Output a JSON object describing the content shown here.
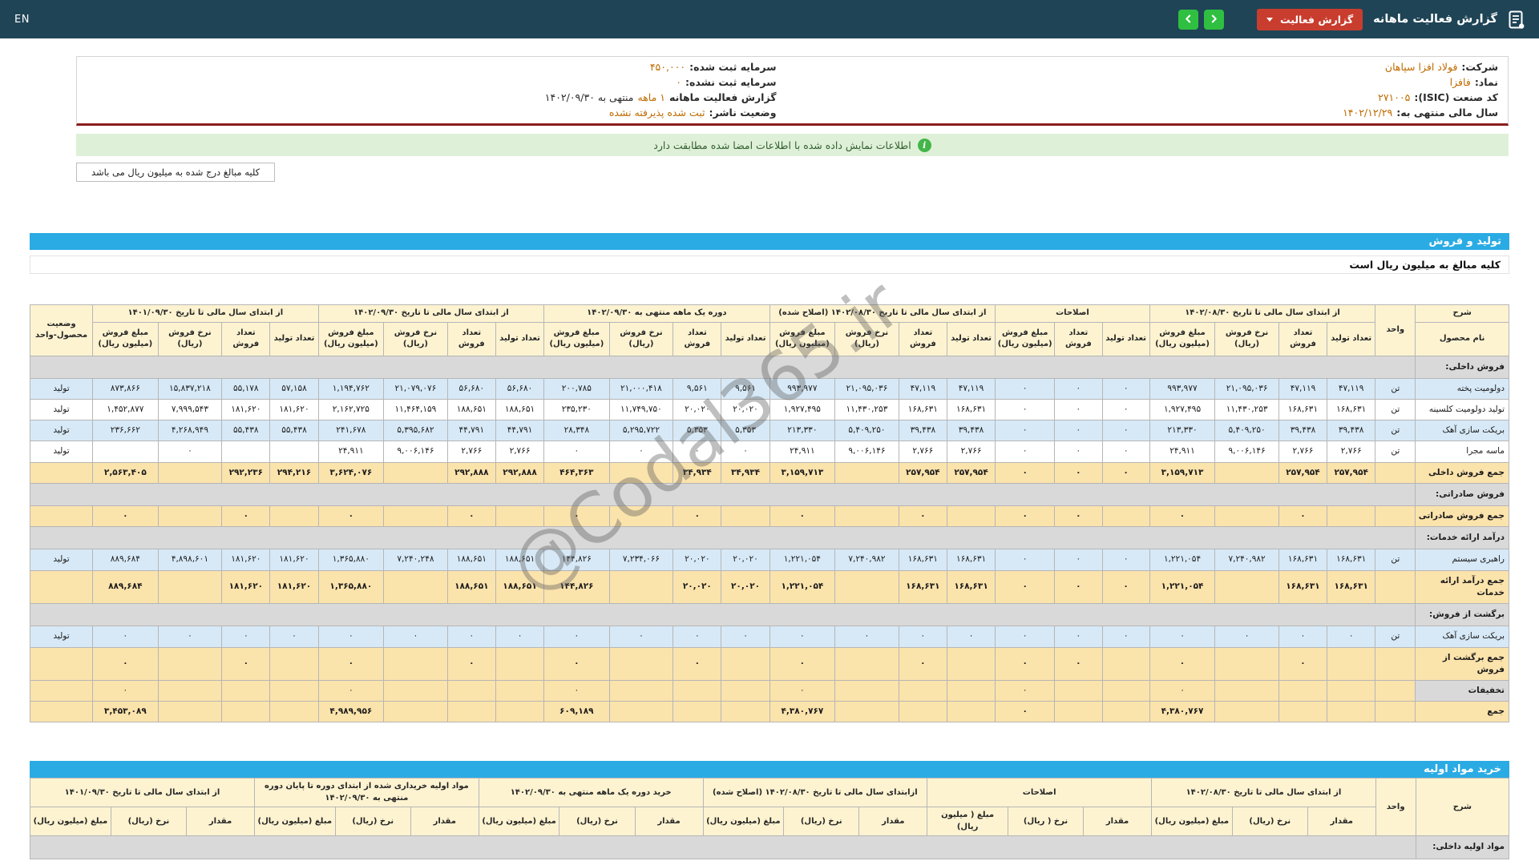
{
  "colors": {
    "topbar": "#1f4456",
    "blue": "#2aabe3",
    "red": "#c93d2e",
    "green": "#2fbf41",
    "maroon": "#8a1c1c",
    "notice_bg": "#dff0d8",
    "header_bg": "#fdf3d1",
    "sum_bg": "#fbe3ac",
    "alt_bg": "#d7e9f7",
    "sec_bg": "#d9d9d9",
    "orange": "#bf6b00"
  },
  "header": {
    "title": "گزارش فعالیت ماهانه",
    "dropdown_label": "گزارش فعالیت",
    "lang": "EN"
  },
  "info": {
    "right": [
      {
        "label": "شرکت:",
        "value": "فولاد افزا سپاهان"
      },
      {
        "label": "نماد:",
        "value": "فافزا"
      },
      {
        "label": "کد صنعت (ISIC):",
        "value": "۲۷۱۰۰۵"
      },
      {
        "label": "سال مالی منتهی به:",
        "value": "۱۴۰۲/۱۲/۲۹"
      }
    ],
    "left": [
      {
        "label": "سرمایه ثبت شده:",
        "value": "۴۵۰,۰۰۰"
      },
      {
        "label": "سرمایه ثبت نشده:",
        "value": "۰"
      },
      {
        "label": "گزارش فعالیت ماهانه",
        "value": "۱ ماهه",
        "suffix": "منتهی به ۱۴۰۲/۰۹/۳۰"
      },
      {
        "label": "وضعیت ناشر:",
        "value": "ثبت شده پذیرفته نشده"
      }
    ]
  },
  "notice": "اطلاعات نمایش داده شده با اطلاعات امضا شده مطابقت دارد",
  "unit_tab": "کلیه مبالغ درج شده به میلیون ریال می باشد",
  "watermark": "@Codal365.ir",
  "sales": {
    "title": "تولید و فروش",
    "subtitle": "کلیه مبالغ به میلیون ریال است",
    "col_desc": "شرح",
    "col_name": "نام محصول",
    "col_unit": "واحد",
    "col_status": "وضعیت محصول-واحد",
    "groups": [
      {
        "title": "از ابتدای سال مالی تا تاریخ ۱۴۰۲/۰۸/۳۰",
        "cols": [
          "تعداد تولید",
          "تعداد فروش",
          "نرخ فروش (ریال)",
          "مبلغ فروش (میلیون ریال)"
        ]
      },
      {
        "title": "اصلاحات",
        "cols": [
          "تعداد تولید",
          "تعداد فروش",
          "مبلغ فروش (میلیون ریال)"
        ]
      },
      {
        "title": "از ابتدای سال مالی تا تاریخ ۱۴۰۲/۰۸/۳۰ (اصلاح شده)",
        "cols": [
          "تعداد تولید",
          "تعداد فروش",
          "نرخ فروش (ریال)",
          "مبلغ فروش (میلیون ریال)"
        ]
      },
      {
        "title": "دوره یک ماهه منتهی به ۱۴۰۲/۰۹/۳۰",
        "cols": [
          "تعداد تولید",
          "تعداد فروش",
          "نرخ فروش (ریال)",
          "مبلغ فروش (میلیون ریال)"
        ]
      },
      {
        "title": "از ابتدای سال مالی تا تاریخ ۱۴۰۲/۰۹/۳۰",
        "cols": [
          "تعداد تولید",
          "تعداد فروش",
          "نرخ فروش (ریال)",
          "مبلغ فروش (میلیون ریال)"
        ]
      },
      {
        "title": "از ابتدای سال مالی تا تاریخ ۱۴۰۱/۰۹/۳۰",
        "cols": [
          "تعداد تولید",
          "تعداد فروش",
          "نرخ فروش (ریال)",
          "مبلغ فروش (میلیون ریال)"
        ]
      }
    ],
    "rows": [
      {
        "type": "section",
        "name": "فروش داخلی:"
      },
      {
        "type": "data",
        "variant": "alt",
        "name": "دولومیت پخته",
        "unit": "تن",
        "status": "تولید",
        "cells": [
          "۴۷,۱۱۹",
          "۴۷,۱۱۹",
          "۲۱,۰۹۵,۰۳۶",
          "۹۹۳,۹۷۷",
          "۰",
          "۰",
          "۰",
          "۴۷,۱۱۹",
          "۴۷,۱۱۹",
          "۲۱,۰۹۵,۰۳۶",
          "۹۹۳,۹۷۷",
          "۹,۵۶۱",
          "۹,۵۶۱",
          "۲۱,۰۰۰,۴۱۸",
          "۲۰۰,۷۸۵",
          "۵۶,۶۸۰",
          "۵۶,۶۸۰",
          "۲۱,۰۷۹,۰۷۶",
          "۱,۱۹۴,۷۶۲",
          "۵۷,۱۵۸",
          "۵۵,۱۷۸",
          "۱۵,۸۳۷,۲۱۸",
          "۸۷۳,۸۶۶"
        ]
      },
      {
        "type": "data",
        "variant": "",
        "name": "تولید دولومیت کلسینه",
        "unit": "تن",
        "status": "تولید",
        "cells": [
          "۱۶۸,۶۳۱",
          "۱۶۸,۶۳۱",
          "۱۱,۴۳۰,۲۵۳",
          "۱,۹۲۷,۴۹۵",
          "۰",
          "۰",
          "۰",
          "۱۶۸,۶۳۱",
          "۱۶۸,۶۳۱",
          "۱۱,۴۳۰,۲۵۳",
          "۱,۹۲۷,۴۹۵",
          "۲۰,۰۲۰",
          "۲۰,۰۲۰",
          "۱۱,۷۴۹,۷۵۰",
          "۲۳۵,۲۳۰",
          "۱۸۸,۶۵۱",
          "۱۸۸,۶۵۱",
          "۱۱,۴۶۴,۱۵۹",
          "۲,۱۶۲,۷۲۵",
          "۱۸۱,۶۲۰",
          "۱۸۱,۶۲۰",
          "۷,۹۹۹,۵۴۳",
          "۱,۴۵۲,۸۷۷"
        ]
      },
      {
        "type": "data",
        "variant": "alt",
        "name": "بریکت سازی آهک",
        "unit": "تن",
        "status": "تولید",
        "cells": [
          "۳۹,۴۳۸",
          "۳۹,۴۳۸",
          "۵,۴۰۹,۲۵۰",
          "۲۱۳,۳۳۰",
          "۰",
          "۰",
          "۰",
          "۳۹,۴۳۸",
          "۳۹,۴۳۸",
          "۵,۴۰۹,۲۵۰",
          "۲۱۳,۳۳۰",
          "۵,۳۵۳",
          "۵,۳۵۳",
          "۵,۲۹۵,۷۲۲",
          "۲۸,۳۴۸",
          "۴۴,۷۹۱",
          "۴۴,۷۹۱",
          "۵,۳۹۵,۶۸۲",
          "۲۴۱,۶۷۸",
          "۵۵,۴۳۸",
          "۵۵,۴۳۸",
          "۴,۲۶۸,۹۴۹",
          "۲۳۶,۶۶۲"
        ]
      },
      {
        "type": "data",
        "variant": "",
        "name": "ماسه مجرا",
        "unit": "تن",
        "status": "تولید",
        "cells": [
          "۲,۷۶۶",
          "۲,۷۶۶",
          "۹,۰۰۶,۱۴۶",
          "۲۴,۹۱۱",
          "۰",
          "۰",
          "۰",
          "۲,۷۶۶",
          "۲,۷۶۶",
          "۹,۰۰۶,۱۴۶",
          "۲۴,۹۱۱",
          "۰",
          "۰",
          "۰",
          "۰",
          "۲,۷۶۶",
          "۲,۷۶۶",
          "۹,۰۰۶,۱۴۶",
          "۲۴,۹۱۱",
          "",
          "",
          "۰",
          ""
        ]
      },
      {
        "type": "data",
        "variant": "sum",
        "name": "جمع فروش داخلی",
        "unit": "",
        "status": "",
        "cells": [
          "۲۵۷,۹۵۴",
          "۲۵۷,۹۵۴",
          "",
          "۳,۱۵۹,۷۱۳",
          "۰",
          "۰",
          "۰",
          "۲۵۷,۹۵۴",
          "۲۵۷,۹۵۴",
          "",
          "۳,۱۵۹,۷۱۳",
          "۳۴,۹۳۴",
          "۳۴,۹۳۴",
          "",
          "۴۶۴,۳۶۳",
          "۲۹۲,۸۸۸",
          "۲۹۲,۸۸۸",
          "",
          "۳,۶۲۴,۰۷۶",
          "۲۹۴,۲۱۶",
          "۲۹۲,۲۳۶",
          "",
          "۲,۵۶۳,۴۰۵"
        ]
      },
      {
        "type": "section",
        "name": "فروش صادراتی:"
      },
      {
        "type": "data",
        "variant": "sum",
        "name": "جمع فروش صادراتی",
        "unit": "",
        "status": "",
        "cells": [
          "",
          "۰",
          "",
          "۰",
          "",
          "۰",
          "۰",
          "",
          "۰",
          "",
          "۰",
          "",
          "۰",
          "",
          "۰",
          "",
          "۰",
          "",
          "۰",
          "",
          "۰",
          "",
          "۰"
        ]
      },
      {
        "type": "section",
        "name": "درآمد ارائه خدمات:"
      },
      {
        "type": "data",
        "variant": "alt",
        "name": "راهبری سیستم",
        "unit": "تن",
        "status": "تولید",
        "cells": [
          "۱۶۸,۶۳۱",
          "۱۶۸,۶۳۱",
          "۷,۲۴۰,۹۸۲",
          "۱,۲۲۱,۰۵۴",
          "۰",
          "۰",
          "۰",
          "۱۶۸,۶۳۱",
          "۱۶۸,۶۳۱",
          "۷,۲۴۰,۹۸۲",
          "۱,۲۲۱,۰۵۴",
          "۲۰,۰۲۰",
          "۲۰,۰۲۰",
          "۷,۲۳۴,۰۶۶",
          "۱۴۴,۸۲۶",
          "۱۸۸,۶۵۱",
          "۱۸۸,۶۵۱",
          "۷,۲۴۰,۲۴۸",
          "۱,۳۶۵,۸۸۰",
          "۱۸۱,۶۲۰",
          "۱۸۱,۶۲۰",
          "۴,۸۹۸,۶۰۱",
          "۸۸۹,۶۸۴"
        ]
      },
      {
        "type": "data",
        "variant": "sum",
        "name": "جمع درآمد ارائه خدمات",
        "unit": "",
        "status": "",
        "cells": [
          "۱۶۸,۶۳۱",
          "۱۶۸,۶۳۱",
          "",
          "۱,۲۲۱,۰۵۴",
          "۰",
          "۰",
          "۰",
          "۱۶۸,۶۳۱",
          "۱۶۸,۶۳۱",
          "",
          "۱,۲۲۱,۰۵۴",
          "۲۰,۰۲۰",
          "۲۰,۰۲۰",
          "",
          "۱۴۴,۸۲۶",
          "۱۸۸,۶۵۱",
          "۱۸۸,۶۵۱",
          "",
          "۱,۳۶۵,۸۸۰",
          "۱۸۱,۶۲۰",
          "۱۸۱,۶۲۰",
          "",
          "۸۸۹,۶۸۴"
        ]
      },
      {
        "type": "section",
        "name": "برگشت از فروش:"
      },
      {
        "type": "data",
        "variant": "alt",
        "name": "بریکت سازی آهک",
        "unit": "تن",
        "status": "تولید",
        "cells": [
          "۰",
          "۰",
          "۰",
          "۰",
          "۰",
          "۰",
          "۰",
          "۰",
          "۰",
          "۰",
          "۰",
          "۰",
          "۰",
          "۰",
          "۰",
          "۰",
          "۰",
          "۰",
          "۰",
          "۰",
          "۰",
          "۰",
          "۰"
        ]
      },
      {
        "type": "data",
        "variant": "sum",
        "name": "جمع برگشت از فروش",
        "unit": "",
        "status": "",
        "cells": [
          "",
          "۰",
          "",
          "۰",
          "",
          "۰",
          "۰",
          "",
          "۰",
          "",
          "۰",
          "",
          "۰",
          "",
          "۰",
          "",
          "۰",
          "",
          "۰",
          "",
          "۰",
          "",
          "۰"
        ]
      },
      {
        "type": "data",
        "variant": "disc",
        "name": "تخفیفات",
        "unit": "",
        "status": "",
        "cells": [
          "",
          "",
          "",
          "۰",
          "",
          "",
          "۰",
          "",
          "",
          "",
          "۰",
          "",
          "",
          "",
          "۰",
          "",
          "",
          "",
          "۰",
          "",
          "",
          "",
          "۰"
        ]
      },
      {
        "type": "data",
        "variant": "sum",
        "name": "جمع",
        "unit": "",
        "status": "",
        "cells": [
          "",
          "",
          "",
          "۴,۳۸۰,۷۶۷",
          "",
          "",
          "۰",
          "",
          "",
          "",
          "۴,۳۸۰,۷۶۷",
          "",
          "",
          "",
          "۶۰۹,۱۸۹",
          "",
          "",
          "",
          "۴,۹۸۹,۹۵۶",
          "",
          "",
          "",
          "۳,۴۵۳,۰۸۹"
        ]
      }
    ]
  },
  "purchase": {
    "title": "خرید مواد اولیه",
    "col_desc": "شرح",
    "col_unit": "واحد",
    "groups": [
      {
        "title": "از ابتدای سال مالی تا تاریخ ۱۴۰۲/۰۸/۳۰",
        "cols": [
          "مقدار",
          "نرخ (ریال)",
          "مبلغ (میلیون ریال)"
        ]
      },
      {
        "title": "اصلاحات",
        "cols": [
          "مقدار",
          "نرخ ( ریال)",
          "مبلغ ( میلیون ریال)"
        ]
      },
      {
        "title": "ازابتدای سال مالی تا تاریخ ۱۴۰۲/۰۸/۳۰ (اصلاح شده)",
        "cols": [
          "مقدار",
          "نرخ (ریال)",
          "مبلغ (میلیون ریال)"
        ]
      },
      {
        "title": "خرید دوره یک ماهه منتهی به ۱۴۰۲/۰۹/۳۰",
        "cols": [
          "مقدار",
          "نرخ (ریال)",
          "مبلغ (میلیون ریال)"
        ]
      },
      {
        "title": "مواد اولیه خریداری شده از ابتدای دوره تا پایان دوره منتهی به ۱۴۰۲/۰۹/۳۰",
        "cols": [
          "مقدار",
          "نرخ (ریال)",
          "مبلغ (میلیون ریال)"
        ]
      },
      {
        "title": "از ابتدای سال مالی تا تاریخ ۱۴۰۱/۰۹/۳۰",
        "cols": [
          "مقدار",
          "نرخ (ریال)",
          "مبلغ (میلیون ریال)"
        ]
      }
    ],
    "rows": [
      {
        "type": "section",
        "name": "مواد اولیه داخلی:"
      }
    ]
  }
}
